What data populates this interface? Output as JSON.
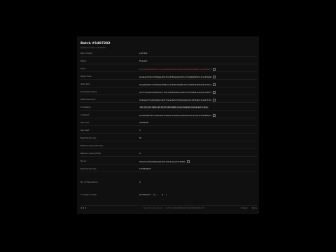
{
  "batch": {
    "title": "Batch #1407202",
    "subtitle": "Details for batch #1407202"
  },
  "rows": [
    {
      "label": "Batch Height",
      "value": "1407202"
    },
    {
      "label": "Status",
      "value": "Finalized"
    },
    {
      "label": "Hash",
      "value": "0x3c9f6fa2e88d3b7c4c1a4e8b5d2f06a17e9b3c4d52e18f7a60b9c3d21e4f8a57"
    },
    {
      "label": "Parent Hash",
      "value": "0xa4b1e7d39c52f08a6e13b7d4c29f85a0e6b3d72c1f94a8e05b6d3c27e19f4a80"
    },
    {
      "label": "State Root",
      "value": "0x5e8d2a4b7c91f03e6a2d58b4c7e19f0a3d6b82c5e71a94f0d2c6b83e5a17f9c2"
    },
    {
      "label": "Transactions Root",
      "value": "0x2f7c9e1b4a63d08f5e2c7b91a4d36e8f0b5c2a97d41e6f83b0c5a92d7e14b6f3"
    },
    {
      "label": "Withdrawal Root",
      "value": "0x9b4e2c7f1a58d36e0c4b9f72a5e18d3c6f0b47a29e5d1c83f6a0b74e2d9c5f18"
    },
    {
      "label": "Timestamp",
      "value": "Sat Oct 05 2024 06:14:35 GMT+0000 (Coordinated Universal Time)"
    },
    {
      "label": "L1 Parent",
      "value": "0xe6d3a90c5b27f48e1d6a3c09b5f72e4d8a1c6b39f05e2d7a4c8b13f6e09d5a27"
    },
    {
      "label": "Gas Limit",
      "value": "30000000"
    },
    {
      "label": "Gas Used",
      "value": "0"
    },
    {
      "label": "Base Fee Per Gas",
      "value": "50"
    },
    {
      "label": "Network Queue (Forced)",
      "value": ""
    },
    {
      "label": "Network Queue (Total)",
      "value": "0"
    },
    {
      "label": "Prover",
      "value": "0x8e3c1a7f52d94b6e0a3f8c2d7b5e19a4f6c0d83b"
    },
    {
      "label": "Base Fee Per Gas",
      "value": "1000000000"
    }
  ],
  "tx_section": {
    "label": "No. of Transactions",
    "value": "0"
  },
  "pagination": {
    "label": "L1 Origin Tx Hash",
    "value": "0x7f4a2c9d...e1",
    "extra": "1"
  },
  "footer": {
    "links": "✱ ✱ ✱",
    "center": "Powered by Blockscout · 0x7f4a2c9d1e5b83f06a2d7c4e9b1f58a30d6e2c7b",
    "right": [
      "Privacy",
      "Terms"
    ]
  }
}
